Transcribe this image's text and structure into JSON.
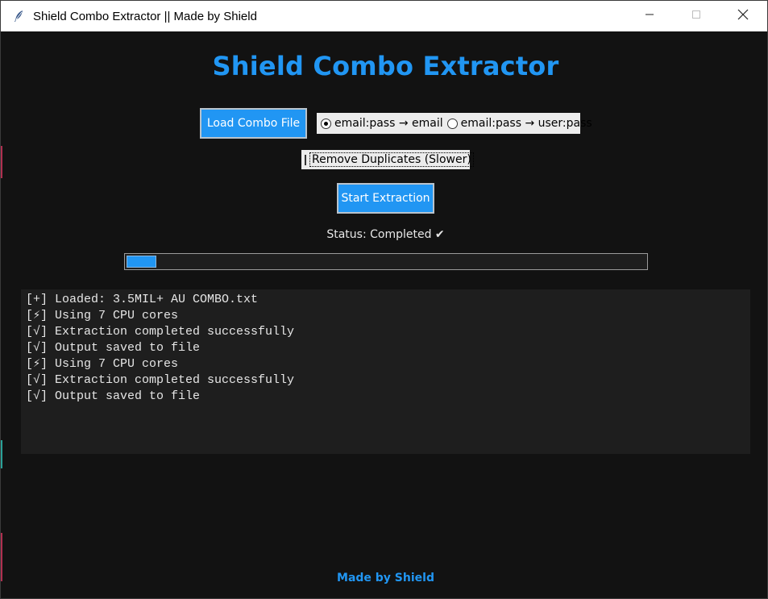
{
  "window": {
    "title": "Shield Combo Extractor || Made by Shield",
    "icon": "feather-icon"
  },
  "header": {
    "title": "Shield Combo Extractor"
  },
  "controls": {
    "load_label": "Load Combo File",
    "mode_options": [
      {
        "label": "email:pass → email",
        "selected": true
      },
      {
        "label": "email:pass → user:pass",
        "selected": false
      }
    ],
    "remove_duplicates": {
      "label": "Remove Duplicates (Slower)",
      "checked": false
    },
    "start_label": "Start Extraction"
  },
  "status": {
    "text": "Status: Completed ✔"
  },
  "progress": {
    "fraction": 0.057
  },
  "console": {
    "lines": [
      "[+] Loaded: 3.5MIL+ AU COMBO.txt",
      "[⚡] Using 7 CPU cores",
      "[√] Extraction completed successfully",
      "[√] Output saved to file",
      "[⚡] Using 7 CPU cores",
      "[√] Extraction completed successfully",
      "[√] Output saved to file"
    ]
  },
  "footer": {
    "text": "Made by Shield"
  },
  "colors": {
    "accent": "#2196f3",
    "background": "#121212",
    "console_bg": "#1e1e1e"
  }
}
